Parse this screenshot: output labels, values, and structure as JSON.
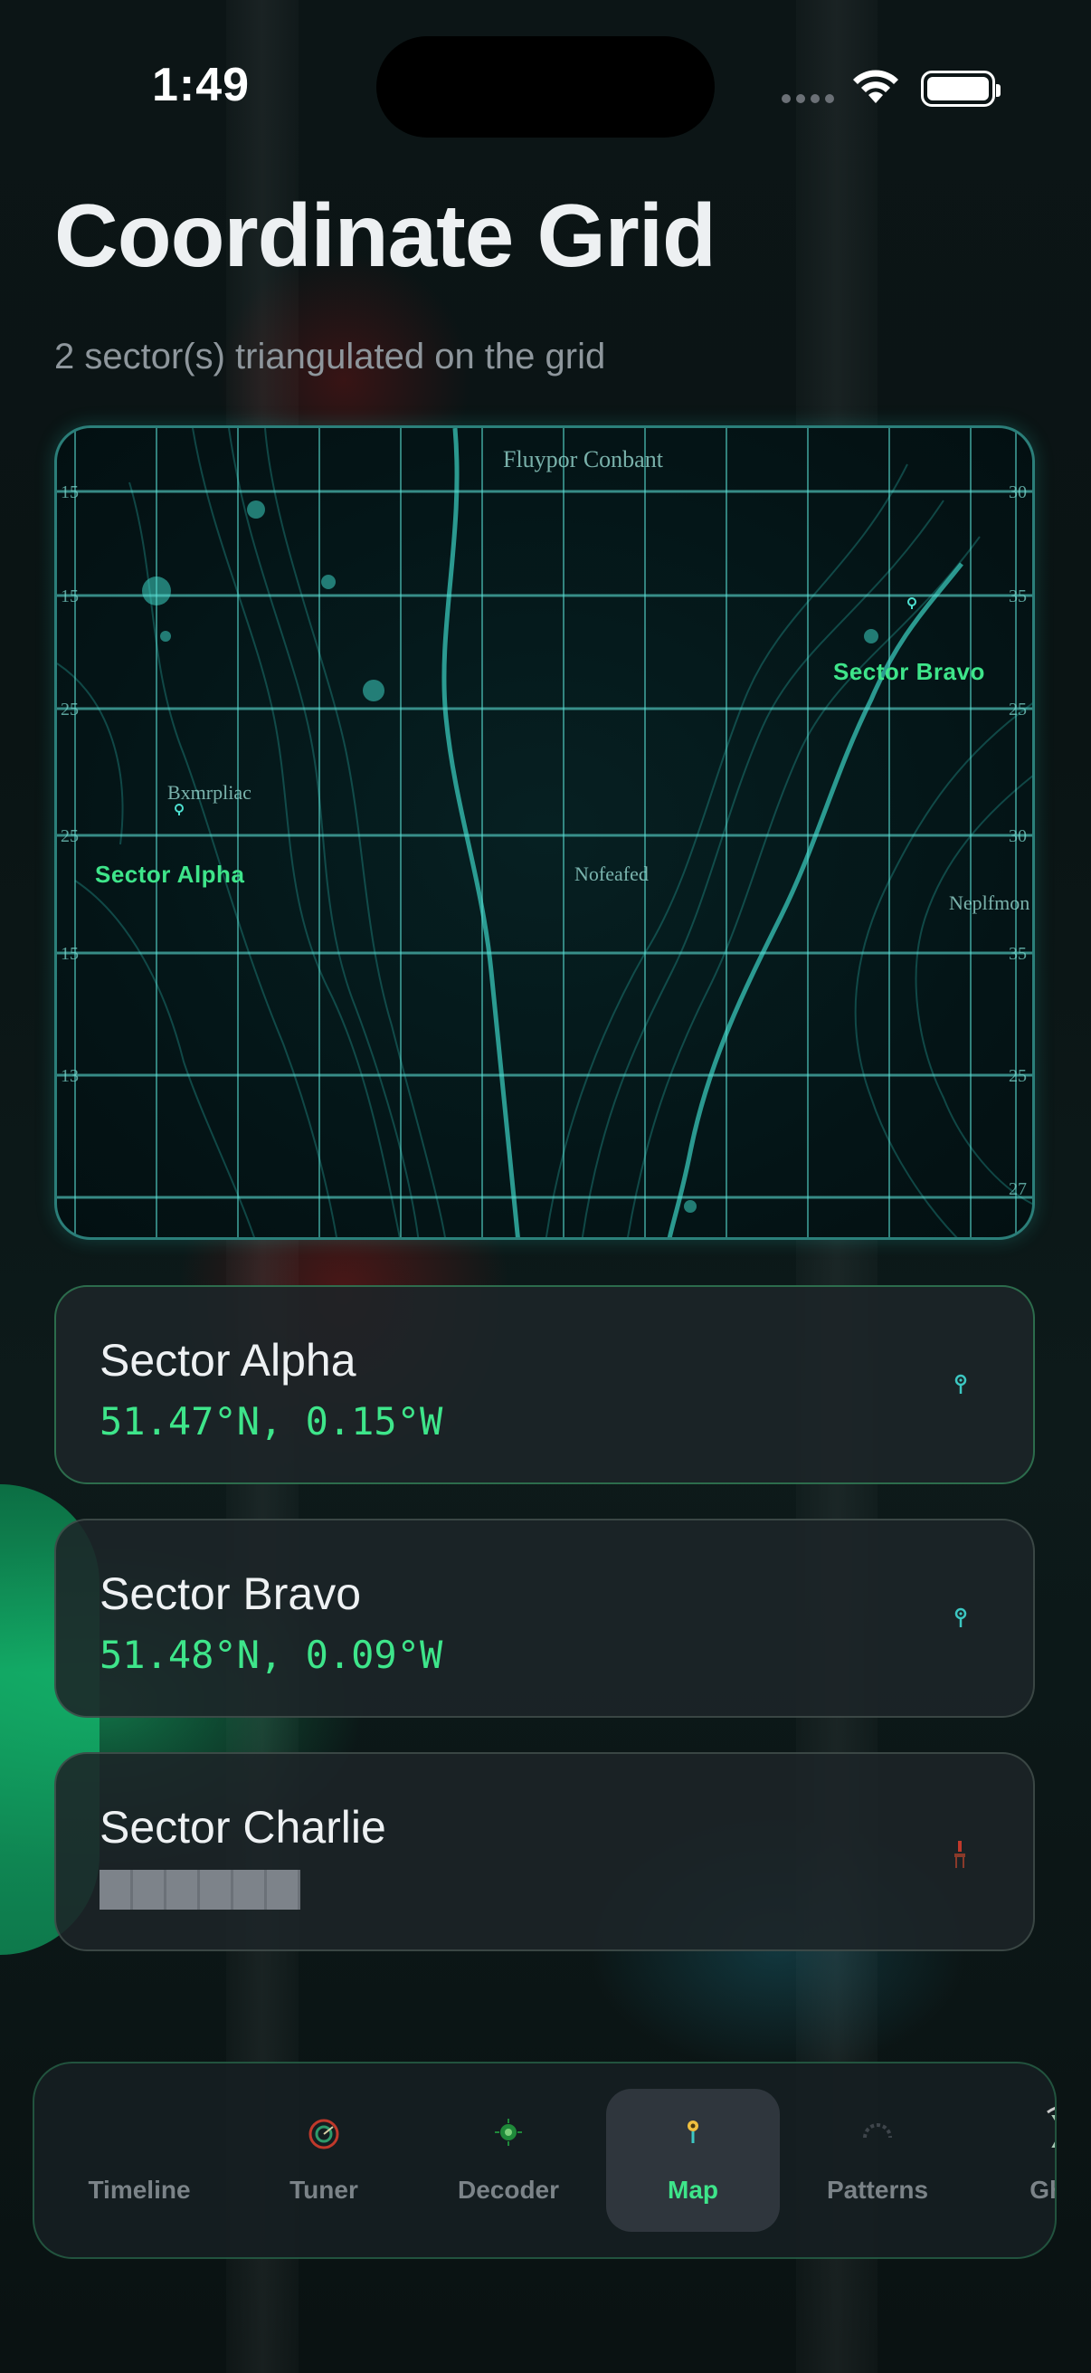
{
  "status_bar": {
    "time": "1:49"
  },
  "header": {
    "title": "Coordinate Grid",
    "subtitle": "2 sector(s) triangulated on the grid"
  },
  "map": {
    "place_labels": [
      "Fluypor Conbant",
      "Bxmrpliac",
      "Nofeafed",
      "Neplfmon"
    ],
    "edge_ticks_left": [
      "15",
      "15",
      "25",
      "25",
      "15",
      "13"
    ],
    "edge_ticks_right": [
      "30",
      "35",
      "25",
      "30",
      "35",
      "25",
      "27"
    ],
    "sector_tags": [
      {
        "name": "Sector Alpha"
      },
      {
        "name": "Sector Bravo"
      }
    ]
  },
  "sectors": [
    {
      "name": "Sector Alpha",
      "coords": "51.47°N, 0.15°W",
      "status": "located",
      "icon": "pin-icon"
    },
    {
      "name": "Sector Bravo",
      "coords": "51.48°N, 0.09°W",
      "status": "located",
      "icon": "pin-icon"
    },
    {
      "name": "Sector Charlie",
      "coords": "",
      "status": "redacted",
      "icon": "warning-icon"
    }
  ],
  "tabs": [
    {
      "label": "Timeline",
      "icon": "timeline-icon",
      "active": false
    },
    {
      "label": "Tuner",
      "icon": "tuner-dial-icon",
      "active": false
    },
    {
      "label": "Decoder",
      "icon": "decoder-icon",
      "active": false
    },
    {
      "label": "Map",
      "icon": "map-pin-icon",
      "active": true
    },
    {
      "label": "Patterns",
      "icon": "patterns-icon",
      "active": false
    },
    {
      "label": "Ghos",
      "icon": "hourglass-icon",
      "active": false
    }
  ],
  "colors": {
    "accent_green": "#3ee58a",
    "map_teal": "#46c8be",
    "warning_red": "#c0392b"
  }
}
